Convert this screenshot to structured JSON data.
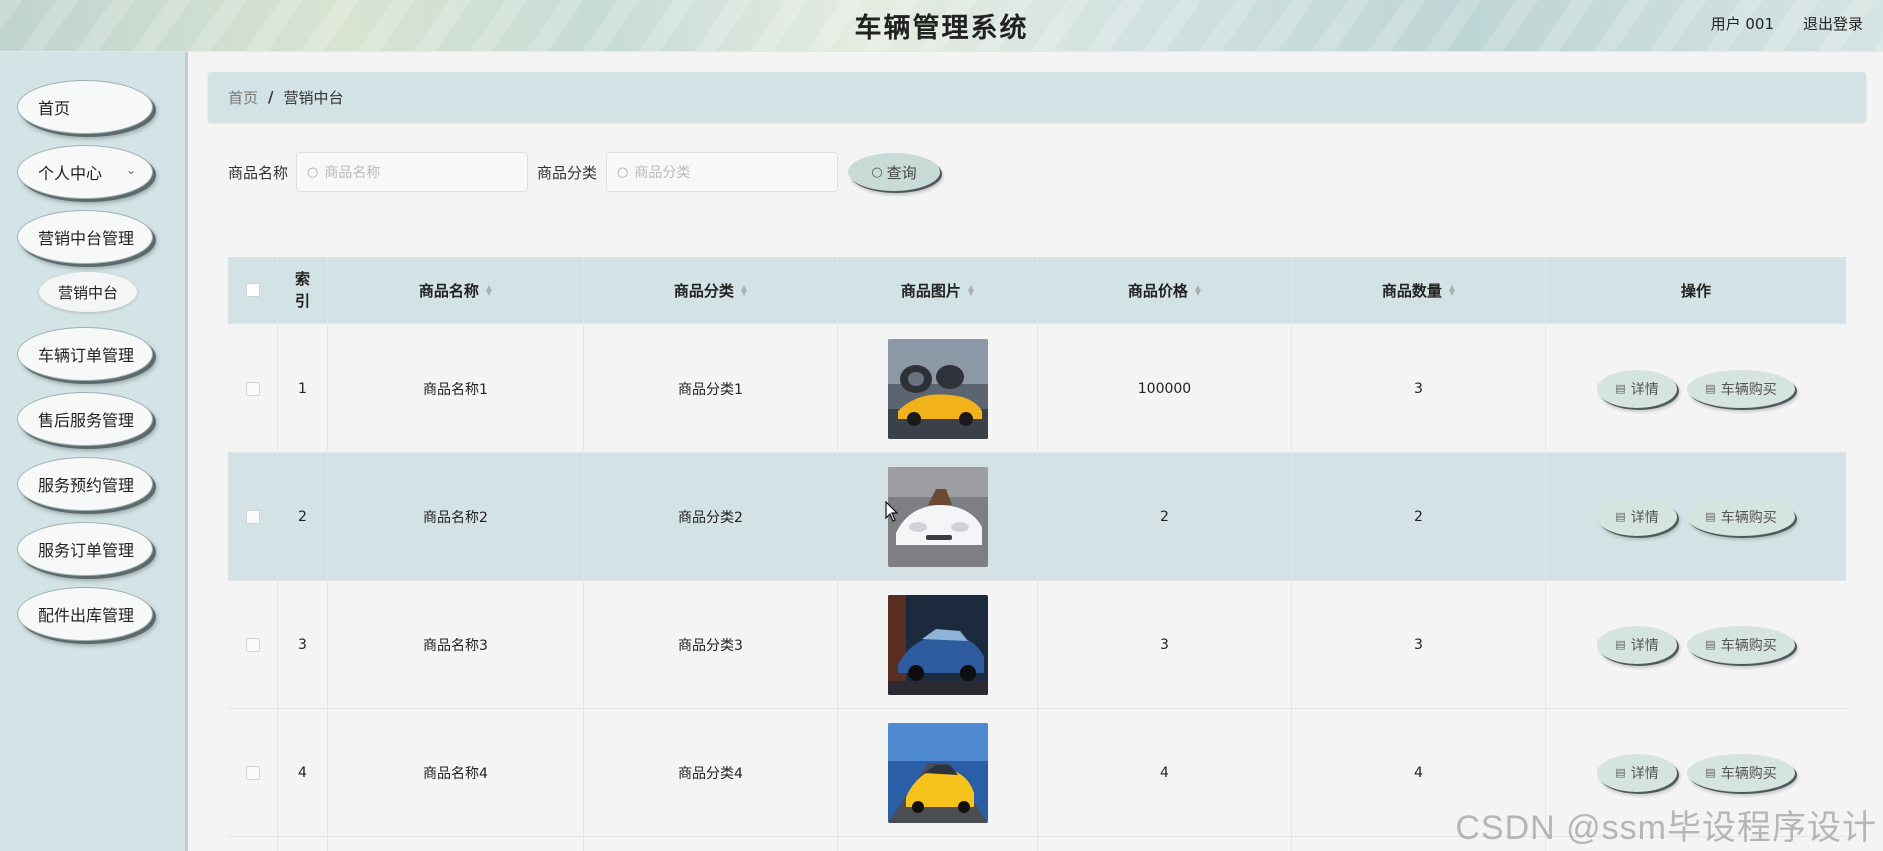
{
  "header": {
    "title": "车辆管理系统",
    "user_label": "用户 001",
    "logout": "退出登录"
  },
  "sidebar": {
    "items": [
      {
        "label": "首页"
      },
      {
        "label": "个人中心"
      },
      {
        "label": "营销中台管理"
      },
      {
        "label": "营销中台"
      },
      {
        "label": "车辆订单管理"
      },
      {
        "label": "售后服务管理"
      },
      {
        "label": "服务预约管理"
      },
      {
        "label": "服务订单管理"
      },
      {
        "label": "配件出库管理"
      }
    ]
  },
  "breadcrumb": {
    "home": "首页",
    "separator": "/",
    "current": "营销中台"
  },
  "search": {
    "name_label": "商品名称",
    "name_placeholder": "商品名称",
    "category_label": "商品分类",
    "category_placeholder": "商品分类",
    "query_button": "查询"
  },
  "table": {
    "headers": {
      "index": "索引",
      "name": "商品名称",
      "category": "商品分类",
      "image": "商品图片",
      "price": "商品价格",
      "quantity": "商品数量",
      "actions": "操作"
    },
    "rows": [
      {
        "index": "1",
        "name": "商品名称1",
        "category": "商品分类1",
        "price": "100000",
        "quantity": "3",
        "detail": "详情",
        "buy": "车辆购买"
      },
      {
        "index": "2",
        "name": "商品名称2",
        "category": "商品分类2",
        "price": "2",
        "quantity": "2",
        "detail": "详情",
        "buy": "车辆购买"
      },
      {
        "index": "3",
        "name": "商品名称3",
        "category": "商品分类3",
        "price": "3",
        "quantity": "3",
        "detail": "详情",
        "buy": "车辆购买"
      },
      {
        "index": "4",
        "name": "商品名称4",
        "category": "商品分类4",
        "price": "4",
        "quantity": "4",
        "detail": "详情",
        "buy": "车辆购买"
      }
    ]
  },
  "watermark": "CSDN @ssm毕设程序设计",
  "colors": {
    "sidebar_bg": "#d3e3e6",
    "header_row_bg": "#d3e2e5",
    "selected_row_bg": "#d5e2e5",
    "page_bg": "#f4f4f4"
  }
}
